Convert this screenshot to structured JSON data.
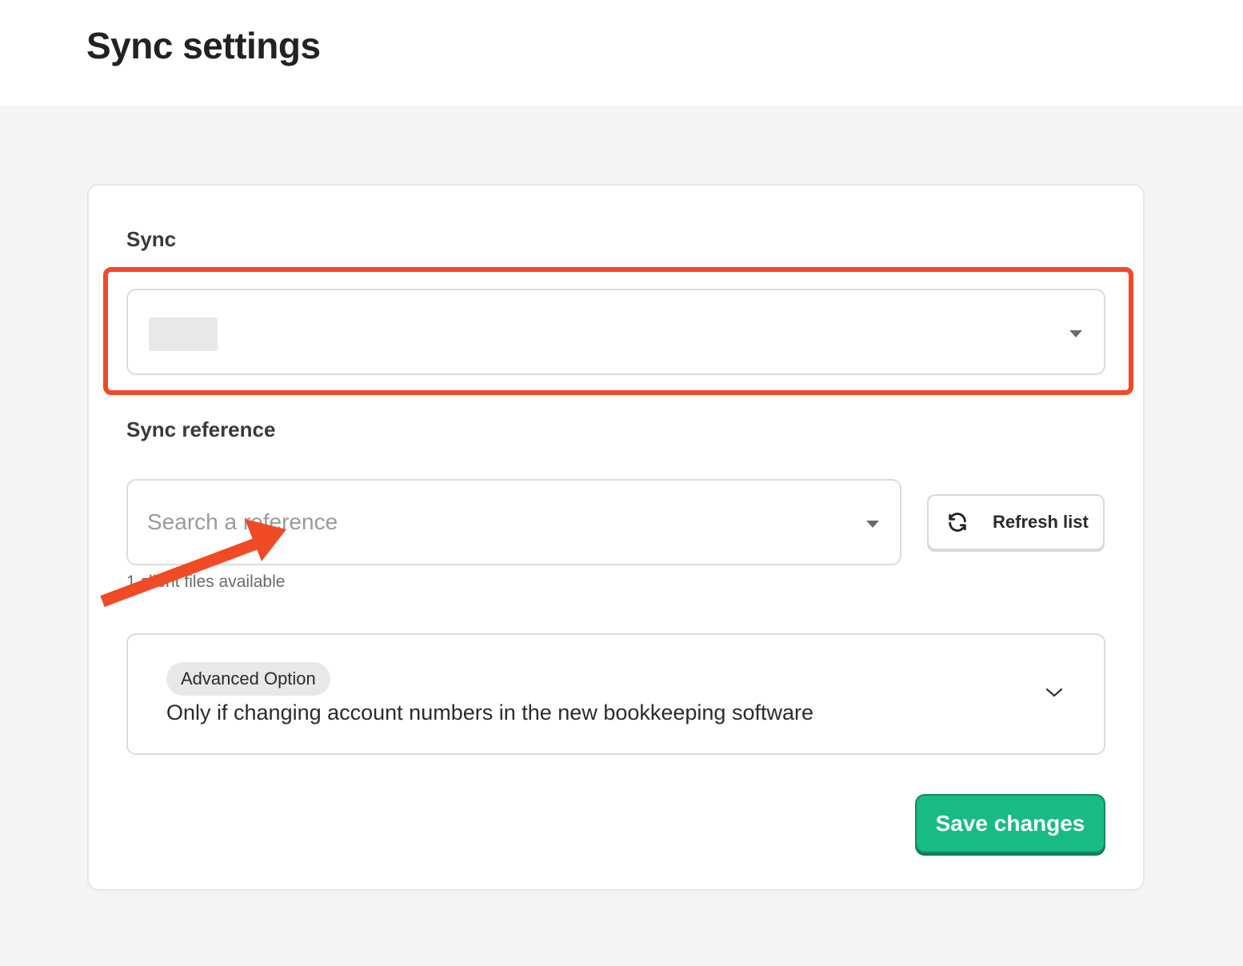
{
  "header": {
    "title": "Sync settings"
  },
  "sync": {
    "label": "Sync",
    "selected_value": ""
  },
  "sync_reference": {
    "label": "Sync reference",
    "placeholder": "Search a reference",
    "helper": "1 client files available",
    "refresh_label": "Refresh list"
  },
  "advanced": {
    "badge": "Advanced Option",
    "description": "Only if changing account numbers in the new bookkeeping software"
  },
  "actions": {
    "save_label": "Save changes"
  },
  "colors": {
    "annotation": "#f04a27",
    "primary": "#17bb83"
  },
  "icons": {
    "refresh": "refresh-icon",
    "caret": "caret-down-icon",
    "chevron": "chevron-down-icon",
    "arrow": "annotation-arrow"
  }
}
